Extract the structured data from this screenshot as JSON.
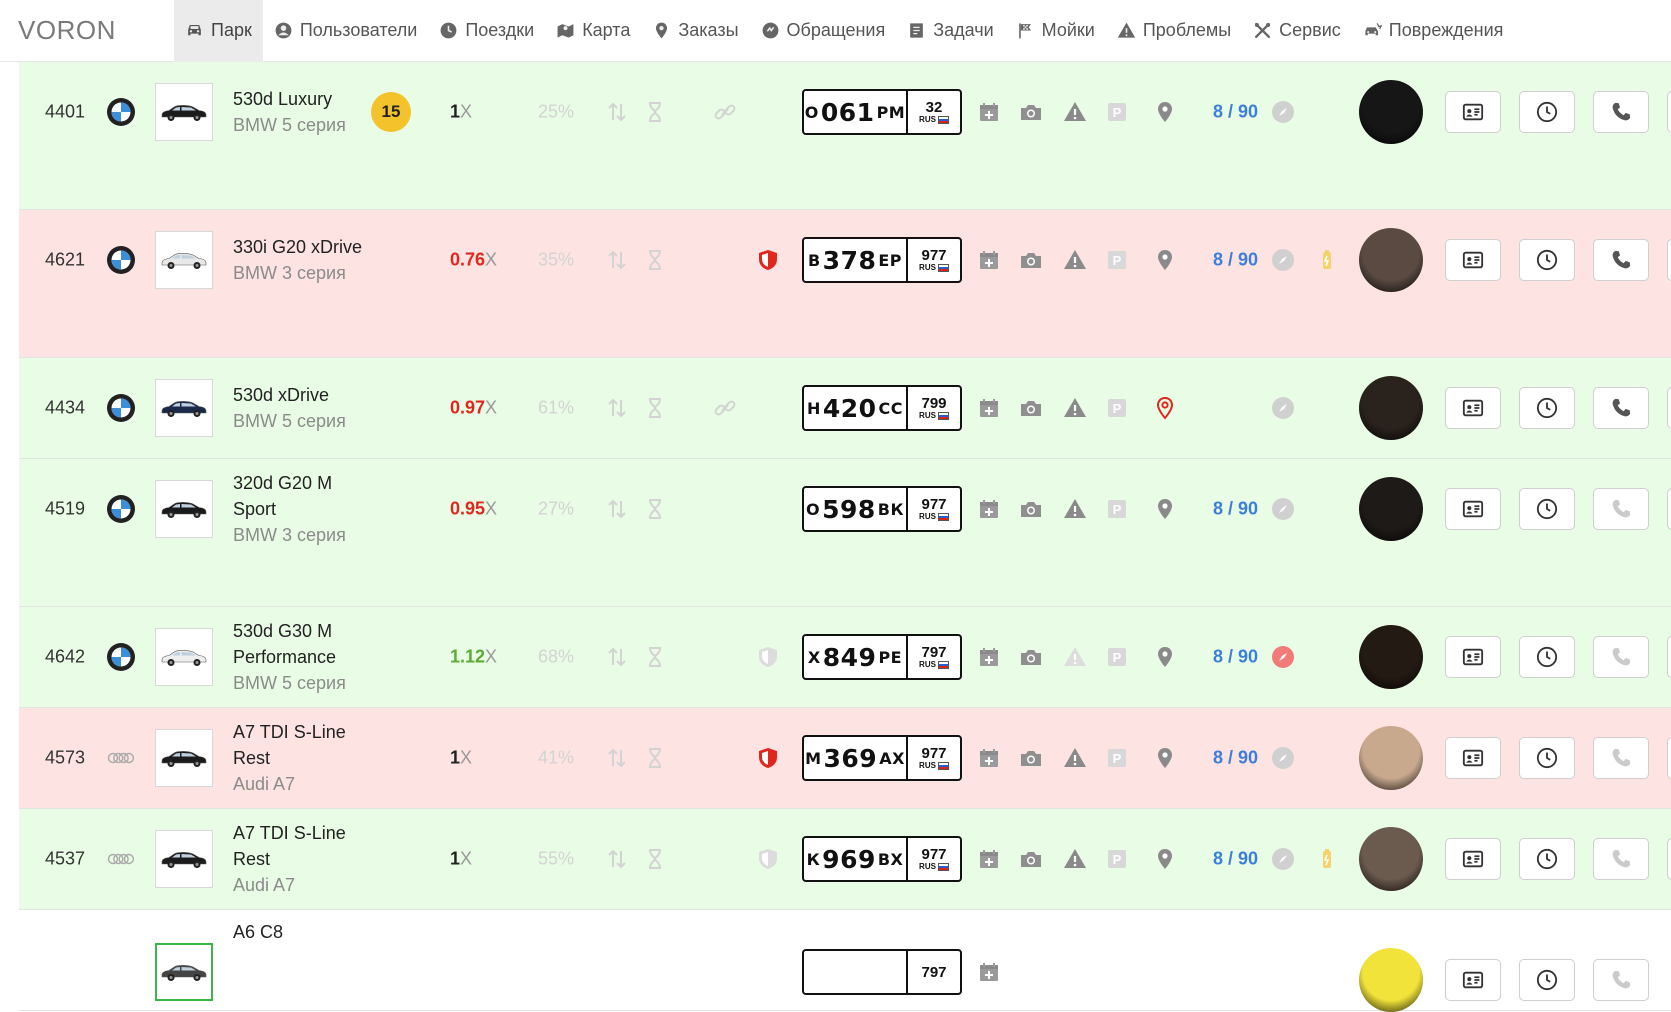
{
  "app": {
    "logo": "VORON"
  },
  "nav": [
    {
      "label": "Парк",
      "icon": "car-icon",
      "active": true
    },
    {
      "label": "Пользователи",
      "icon": "user-icon",
      "active": false
    },
    {
      "label": "Поездки",
      "icon": "clock-icon",
      "active": false
    },
    {
      "label": "Карта",
      "icon": "map-icon",
      "active": false
    },
    {
      "label": "Заказы",
      "icon": "pin-icon",
      "active": false
    },
    {
      "label": "Обращения",
      "icon": "chat-icon",
      "active": false
    },
    {
      "label": "Задачи",
      "icon": "task-icon",
      "active": false
    },
    {
      "label": "Мойки",
      "icon": "flag-icon",
      "active": false
    },
    {
      "label": "Проблемы",
      "icon": "warning-icon",
      "active": false
    },
    {
      "label": "Сервис",
      "icon": "tools-icon",
      "active": false
    },
    {
      "label": "Повреждения",
      "icon": "car-damage-icon",
      "active": false
    }
  ],
  "rows": [
    {
      "id": "4401",
      "brand": "bmw-logo",
      "model": "530d Luxury",
      "series": "BMW 5 серия",
      "badge": "15",
      "coef_value": "1",
      "coef_suffix": "X",
      "coef_color": "black",
      "pct": "25%",
      "shield": "none",
      "plate": {
        "letter1": "О",
        "digits": "061",
        "letters2": "РМ",
        "region": "32",
        "country": "RUS"
      },
      "location": "normal",
      "ratio": "8 / 90",
      "compass": "grey",
      "battery": false,
      "phone_active": true,
      "bg": "green",
      "car_color": "#1c1c1c",
      "avatar_bg": "#161616"
    },
    {
      "id": "4621",
      "brand": "bmw-logo",
      "model": "330i G20 xDrive",
      "series": "BMW 3 серия",
      "badge": "",
      "coef_value": "0.76",
      "coef_suffix": "X",
      "coef_color": "red",
      "pct": "35%",
      "shield": "red",
      "plate": {
        "letter1": "В",
        "digits": "378",
        "letters2": "ЕР",
        "region": "977",
        "country": "RUS"
      },
      "location": "normal",
      "ratio": "8 / 90",
      "compass": "grey",
      "battery": true,
      "phone_active": true,
      "bg": "red",
      "car_color": "#e8e8e8",
      "avatar_bg": "#5a4a42"
    },
    {
      "id": "4434",
      "brand": "bmw-logo",
      "model": "530d xDrive",
      "series": "BMW 5 серия",
      "badge": "",
      "coef_value": "0.97",
      "coef_suffix": "X",
      "coef_color": "red",
      "pct": "61%",
      "shield": "none",
      "plate": {
        "letter1": "Н",
        "digits": "420",
        "letters2": "СС",
        "region": "799",
        "country": "RUS"
      },
      "location": "alert",
      "ratio": "",
      "compass": "grey",
      "battery": false,
      "phone_active": true,
      "bg": "green",
      "car_color": "#1b2a4a",
      "avatar_bg": "#2a221c"
    },
    {
      "id": "4519",
      "brand": "bmw-logo",
      "model": "320d G20 M Sport",
      "series": "BMW 3 серия",
      "badge": "",
      "coef_value": "0.95",
      "coef_suffix": "X",
      "coef_color": "red",
      "pct": "27%",
      "shield": "none",
      "plate": {
        "letter1": "О",
        "digits": "598",
        "letters2": "ВК",
        "region": "977",
        "country": "RUS"
      },
      "location": "normal",
      "ratio": "8 / 90",
      "compass": "grey",
      "battery": false,
      "phone_active": false,
      "bg": "green",
      "car_color": "#1a1a1a",
      "avatar_bg": "#1e1a18"
    },
    {
      "id": "4642",
      "brand": "bmw-logo",
      "model": "530d G30 M Performance",
      "series": "BMW 5 серия",
      "badge": "",
      "coef_value": "1.12",
      "coef_suffix": "X",
      "coef_color": "green",
      "pct": "68%",
      "shield": "faded",
      "plate": {
        "letter1": "Х",
        "digits": "849",
        "letters2": "РЕ",
        "region": "797",
        "country": "RUS"
      },
      "location": "normal",
      "ratio": "8 / 90",
      "compass": "red",
      "battery": false,
      "phone_active": false,
      "bg": "green",
      "car_color": "#eeeeee",
      "avatar_bg": "#241a14"
    },
    {
      "id": "4573",
      "brand": "audi-logo",
      "model": "A7 TDI S-Line Rest",
      "series": "Audi A7",
      "badge": "",
      "coef_value": "1",
      "coef_suffix": "X",
      "coef_color": "black",
      "pct": "41%",
      "shield": "red",
      "plate": {
        "letter1": "М",
        "digits": "369",
        "letters2": "АХ",
        "region": "977",
        "country": "RUS"
      },
      "location": "normal",
      "ratio": "8 / 90",
      "compass": "grey",
      "battery": false,
      "phone_active": false,
      "bg": "red",
      "car_color": "#1c1c1c",
      "avatar_bg": "#c9a98e"
    },
    {
      "id": "4537",
      "brand": "audi-logo",
      "model": "A7 TDI S-Line Rest",
      "series": "Audi A7",
      "badge": "",
      "coef_value": "1",
      "coef_suffix": "X",
      "coef_color": "black",
      "pct": "55%",
      "shield": "faded",
      "plate": {
        "letter1": "К",
        "digits": "969",
        "letters2": "ВХ",
        "region": "977",
        "country": "RUS"
      },
      "location": "normal",
      "ratio": "8 / 90",
      "compass": "grey",
      "battery": true,
      "phone_active": false,
      "bg": "green",
      "car_color": "#1c1c1c",
      "avatar_bg": "#6b5a4e"
    },
    {
      "id": "",
      "brand": "",
      "model": "A6 C8",
      "series": "",
      "badge": "",
      "coef_value": "",
      "coef_suffix": "",
      "coef_color": "black",
      "pct": "",
      "shield": "none",
      "plate": {
        "letter1": "",
        "digits": "",
        "letters2": "",
        "region": "797",
        "country": ""
      },
      "location": "none",
      "ratio": "",
      "compass": "grey",
      "battery": false,
      "phone_active": false,
      "bg": "white",
      "car_color": "#444444",
      "avatar_bg": "#f2e33a"
    }
  ]
}
